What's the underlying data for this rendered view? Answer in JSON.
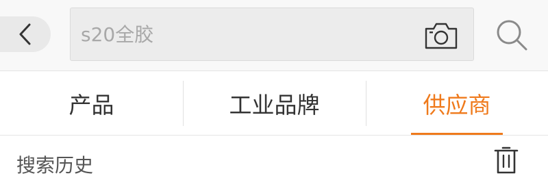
{
  "search": {
    "placeholder": "s20全胶",
    "back_icon": "chevron-left-icon",
    "camera_icon": "camera-icon",
    "search_icon": "search-icon"
  },
  "tabs": [
    {
      "label": "产品",
      "active": false
    },
    {
      "label": "工业品牌",
      "active": false
    },
    {
      "label": "供应商",
      "active": true
    }
  ],
  "history": {
    "title": "搜索历史",
    "clear_icon": "trash-icon"
  },
  "colors": {
    "accent": "#ef7a1c",
    "header_bg": "#f8f8f8",
    "text": "#333333",
    "muted": "#a8a8a8"
  }
}
